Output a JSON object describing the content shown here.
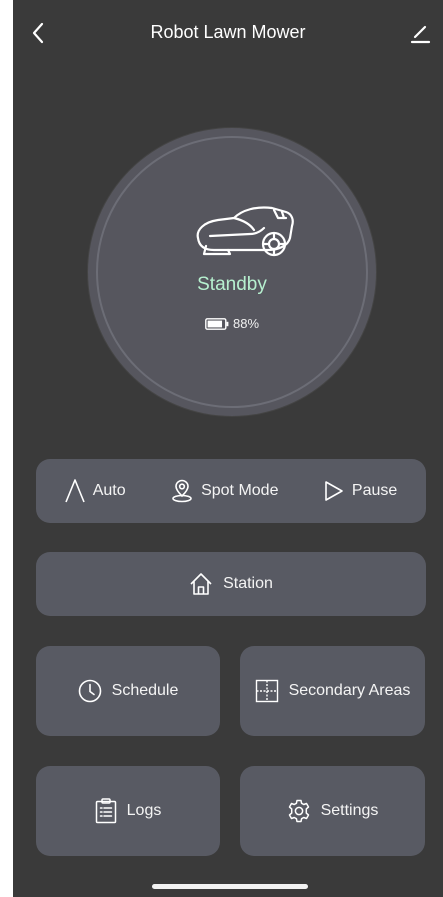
{
  "header": {
    "title": "Robot Lawn Mower",
    "back_icon": "chevron-left-icon",
    "edit_icon": "pencil-icon"
  },
  "status": {
    "state": "Standby",
    "battery_percent": "88%",
    "battery_level": 0.88,
    "state_color": "#b6f0cf"
  },
  "modes": [
    {
      "label": "Auto",
      "icon": "letter-a-icon"
    },
    {
      "label": "Spot Mode",
      "icon": "location-pin-icon"
    },
    {
      "label": "Pause",
      "icon": "play-triangle-icon"
    }
  ],
  "station": {
    "label": "Station",
    "icon": "home-icon"
  },
  "grid": {
    "schedule": {
      "label": "Schedule",
      "icon": "clock-icon"
    },
    "secondary_areas": {
      "label": "Secondary Areas",
      "icon": "map-grid-icon"
    },
    "logs": {
      "label": "Logs",
      "icon": "clipboard-icon"
    },
    "settings": {
      "label": "Settings",
      "icon": "gear-icon"
    }
  },
  "colors": {
    "background": "#3a3a3a",
    "card": "#585a63",
    "circle": "#56565e"
  }
}
